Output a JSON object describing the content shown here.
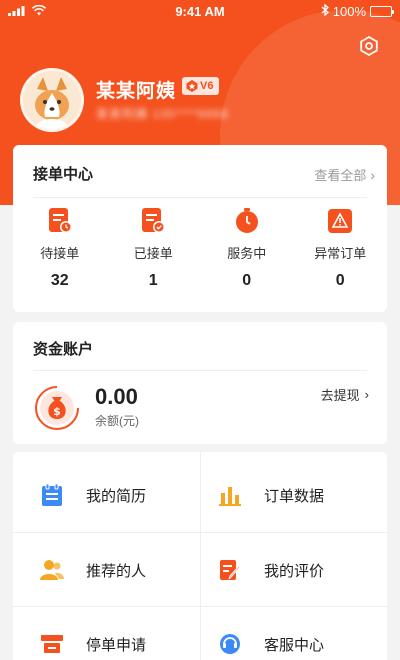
{
  "status_bar": {
    "time": "9:41 AM",
    "battery": "100%"
  },
  "profile": {
    "name": "某某阿姨",
    "level": "V6",
    "phone": "某某阿姨 135****8888"
  },
  "orders": {
    "title": "接单中心",
    "view_all": "查看全部",
    "stats": [
      {
        "label": "待接单",
        "value": "32",
        "icon": "pending-order-icon"
      },
      {
        "label": "已接单",
        "value": "1",
        "icon": "accepted-order-icon"
      },
      {
        "label": "服务中",
        "value": "0",
        "icon": "in-service-icon"
      },
      {
        "label": "异常订单",
        "value": "0",
        "icon": "abnormal-order-icon"
      }
    ]
  },
  "funds": {
    "title": "资金账户",
    "amount": "0.00",
    "amount_label": "余额(元)",
    "withdraw": "去提现"
  },
  "menu": [
    {
      "label": "我的简历",
      "icon": "resume-icon"
    },
    {
      "label": "订单数据",
      "icon": "order-data-icon"
    },
    {
      "label": "推荐的人",
      "icon": "referral-icon"
    },
    {
      "label": "我的评价",
      "icon": "review-icon"
    },
    {
      "label": "停单申请",
      "icon": "pause-order-icon"
    },
    {
      "label": "客服中心",
      "icon": "customer-service-icon"
    }
  ],
  "colors": {
    "primary": "#f4511e",
    "blue": "#3d8af7",
    "amber": "#f5a623"
  }
}
